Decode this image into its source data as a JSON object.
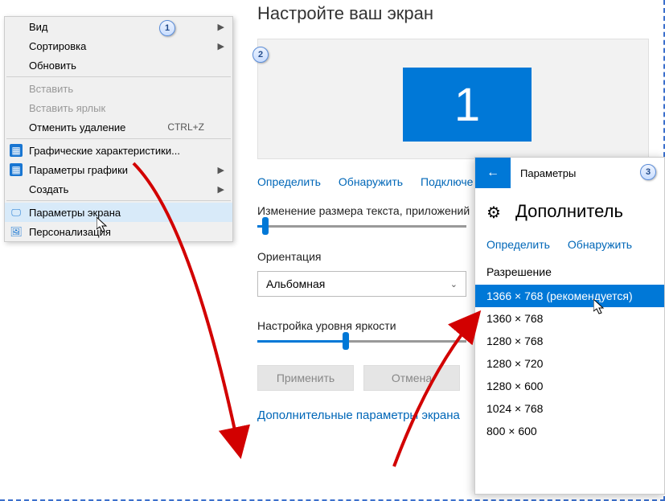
{
  "context_menu": {
    "items": [
      {
        "label": "Вид",
        "has_arrow": true
      },
      {
        "label": "Сортировка",
        "has_arrow": true
      },
      {
        "label": "Обновить"
      },
      {
        "sep": true
      },
      {
        "label": "Вставить",
        "disabled": true
      },
      {
        "label": "Вставить ярлык",
        "disabled": true
      },
      {
        "label": "Отменить удаление",
        "shortcut": "CTRL+Z"
      },
      {
        "sep": true
      },
      {
        "label": "Графические характеристики...",
        "icon": "chip"
      },
      {
        "label": "Параметры графики",
        "icon": "chip",
        "has_arrow": true
      },
      {
        "label": "Создать",
        "has_arrow": true
      },
      {
        "sep": true
      },
      {
        "label": "Параметры экрана",
        "icon": "monitor",
        "highlighted": true
      },
      {
        "label": "Персонализация",
        "icon": "personalize"
      }
    ]
  },
  "settings": {
    "title": "Настройте ваш экран",
    "monitor_number": "1",
    "links": {
      "identify": "Определить",
      "detect": "Обнаружить",
      "connect": "Подключе"
    },
    "text_size_label": "Изменение размера текста, приложений",
    "orientation_label": "Ориентация",
    "orientation_value": "Альбомная",
    "brightness_label": "Настройка уровня яркости",
    "apply": "Применить",
    "cancel": "Отмена",
    "advanced_link": "Дополнительные параметры экрана"
  },
  "advanced": {
    "header_title": "Параметры",
    "title": "Дополнитель",
    "links": {
      "identify": "Определить",
      "detect": "Обнаружить"
    },
    "resolution_label": "Разрешение",
    "resolutions": [
      "1366 × 768 (рекомендуется)",
      "1360 × 768",
      "1280 × 768",
      "1280 × 720",
      "1280 × 600",
      "1024 × 768",
      "800 × 600"
    ],
    "selected_index": 0
  },
  "annotations": {
    "n1": "1",
    "n2": "2",
    "n3": "3"
  }
}
